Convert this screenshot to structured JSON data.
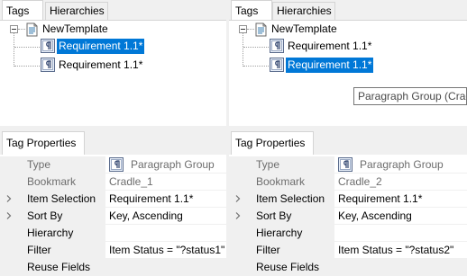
{
  "left_top": {
    "tabs": [
      {
        "label": "Tags"
      },
      {
        "label": "Hierarchies"
      }
    ],
    "tree": {
      "root": "NewTemplate",
      "children": [
        "Requirement 1.1*",
        "Requirement 1.1*"
      ]
    }
  },
  "right_top": {
    "tabs": [
      {
        "label": "Tags"
      },
      {
        "label": "Hierarchies"
      }
    ],
    "tree": {
      "root": "NewTemplate",
      "children": [
        "Requirement 1.1*",
        "Requirement 1.1*"
      ]
    },
    "tooltip": "Paragraph Group (Crad"
  },
  "left_bottom": {
    "tab": "Tag Properties",
    "rows": [
      {
        "name": "Type",
        "value": "Paragraph Group"
      },
      {
        "name": "Bookmark",
        "value": "Cradle_1"
      },
      {
        "name": "Item Selection",
        "value": "Requirement 1.1*"
      },
      {
        "name": "Sort By",
        "value": "Key, Ascending"
      },
      {
        "name": "Hierarchy",
        "value": ""
      },
      {
        "name": "Filter",
        "value": "Item Status = \"?status1\""
      },
      {
        "name": "Reuse Fields",
        "value": ""
      }
    ]
  },
  "right_bottom": {
    "tab": "Tag Properties",
    "rows": [
      {
        "name": "Type",
        "value": "Paragraph Group"
      },
      {
        "name": "Bookmark",
        "value": "Cradle_2"
      },
      {
        "name": "Item Selection",
        "value": "Requirement 1.1*"
      },
      {
        "name": "Sort By",
        "value": "Key, Ascending"
      },
      {
        "name": "Hierarchy",
        "value": ""
      },
      {
        "name": "Filter",
        "value": "Item Status = \"?status2\""
      },
      {
        "name": "Reuse Fields",
        "value": ""
      }
    ]
  },
  "colors": {
    "selection": "#0078d7",
    "panel": "#f0f0f0"
  }
}
